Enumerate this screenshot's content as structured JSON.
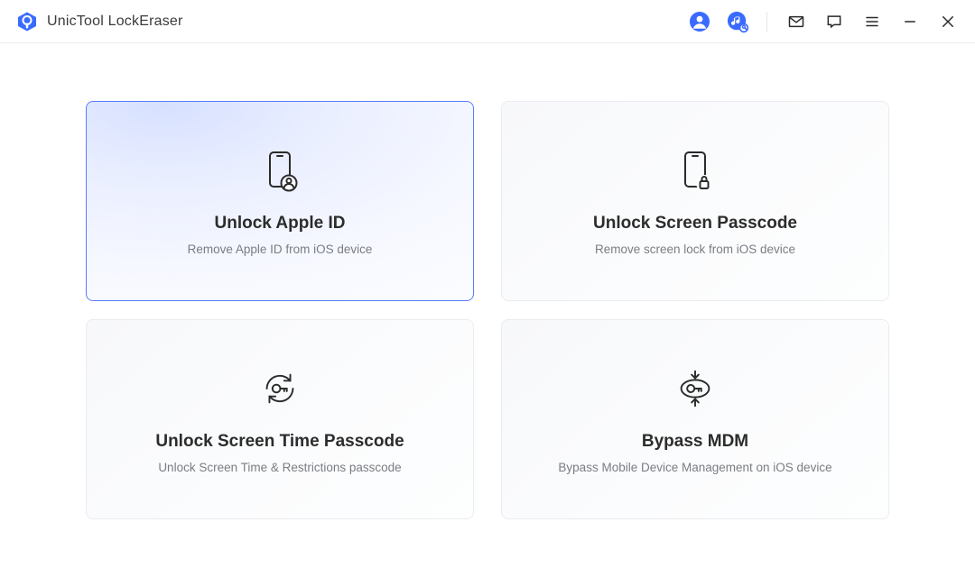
{
  "app": {
    "title": "UnicTool LockEraser"
  },
  "titlebar_icons": {
    "account": "account-icon",
    "music": "music-app-icon",
    "mail": "mail-icon",
    "chat": "chat-icon",
    "menu": "menu-icon",
    "minimize": "minimize-icon",
    "close": "close-icon"
  },
  "cards": [
    {
      "id": "unlock-apple-id",
      "title": "Unlock Apple ID",
      "subtitle": "Remove Apple ID from iOS device",
      "selected": true
    },
    {
      "id": "unlock-screen-passcode",
      "title": "Unlock Screen Passcode",
      "subtitle": "Remove screen lock from iOS device",
      "selected": false
    },
    {
      "id": "unlock-screen-time",
      "title": "Unlock Screen Time Passcode",
      "subtitle": "Unlock Screen Time & Restrictions passcode",
      "selected": false
    },
    {
      "id": "bypass-mdm",
      "title": "Bypass MDM",
      "subtitle": "Bypass Mobile Device Management on iOS device",
      "selected": false
    }
  ],
  "colors": {
    "accent": "#3a6bff",
    "border_selected": "#5c7cfa",
    "text_muted": "#7a7d83"
  }
}
